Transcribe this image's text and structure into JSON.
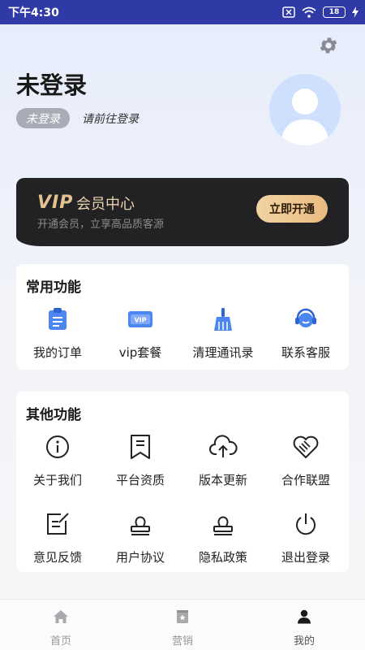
{
  "status_bar": {
    "time": "下午4:30",
    "battery": "18"
  },
  "header": {
    "title": "未登录",
    "badge": "未登录",
    "hint": "请前往登录"
  },
  "vip": {
    "logo": "VIP",
    "title": "会员中心",
    "subtitle": "开通会员，立享高品质客源",
    "button": "立即开通",
    "colors": {
      "card": "#222224",
      "gold": "#e3c28f"
    }
  },
  "common": {
    "title": "常用功能",
    "items": [
      {
        "label": "我的订单",
        "icon": "order-icon"
      },
      {
        "label": "vip套餐",
        "icon": "vip-package-icon"
      },
      {
        "label": "清理通讯录",
        "icon": "broom-icon"
      },
      {
        "label": "联系客服",
        "icon": "customer-service-icon"
      }
    ]
  },
  "other": {
    "title": "其他功能",
    "items": [
      {
        "label": "关于我们",
        "icon": "info-icon"
      },
      {
        "label": "平台资质",
        "icon": "bookmark-icon"
      },
      {
        "label": "版本更新",
        "icon": "cloud-upload-icon"
      },
      {
        "label": "合作联盟",
        "icon": "handshake-heart-icon"
      },
      {
        "label": "意见反馈",
        "icon": "feedback-icon"
      },
      {
        "label": "用户协议",
        "icon": "stamp-icon"
      },
      {
        "label": "隐私政策",
        "icon": "stamp-icon"
      },
      {
        "label": "退出登录",
        "icon": "power-icon"
      }
    ]
  },
  "tabbar": {
    "items": [
      {
        "label": "首页",
        "icon": "home-icon"
      },
      {
        "label": "营销",
        "icon": "marketing-icon"
      },
      {
        "label": "我的",
        "icon": "profile-icon"
      }
    ],
    "active": "我的"
  }
}
